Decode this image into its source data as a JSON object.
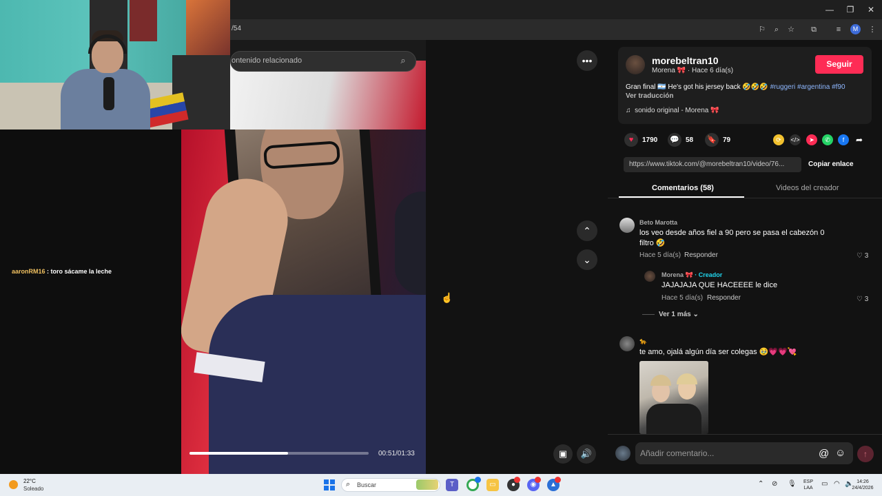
{
  "browser": {
    "url_fragment": "/54",
    "window_controls": [
      "—",
      "❐",
      "✕"
    ]
  },
  "stream": {
    "chat_user": "aaronRM16",
    "chat_message": " : toro sácame la leche"
  },
  "video": {
    "related_placeholder": "ontenido relacionado",
    "timecode": "00:51/01:33",
    "progress": 0.55
  },
  "post": {
    "username": "morebeltran10",
    "display_name": "Morena 🎀",
    "posted_ago": " · Hace 6 día(s)",
    "follow_label": "Seguir",
    "caption_text": "Gran final 🇦🇷 He's got his jersey back 🤣🤣🤣 ",
    "hashtags": "#ruggeri #argentina #f90",
    "translate_label": "Ver traducción",
    "sound_label": "sonido original - Morena 🎀",
    "likes": "1790",
    "comments": "58",
    "saves": "79",
    "link_url": "https://www.tiktok.com/@morebeltran10/video/76...",
    "copy_link_label": "Copiar enlace"
  },
  "tabs": {
    "comments": "Comentarios (58)",
    "creator_videos": "Videos del creador"
  },
  "comments": [
    {
      "user": "Beto Marotta",
      "text": "los veo desde años fiel a 90 pero se pasa el cabezón 0 filtro 🤣",
      "time": "Hace 5 día(s)",
      "reply_label": "Responder",
      "likes": "3"
    },
    {
      "user": "Morena 🎀",
      "creator_tag": " · Creador",
      "text": "JAJAJAJA QUE HACEEEE le dice",
      "time": "Hace 5 día(s)",
      "reply_label": "Responder",
      "likes": "3"
    },
    {
      "user": "🐆",
      "text": "te amo, ojalá algún día ser colegas 🥹💗💗💘"
    }
  ],
  "more_replies_label": "Ver 1 más ⌄",
  "add_comment_placeholder": "Añadir comentario...",
  "taskbar": {
    "temp": "22°C",
    "weather": "Soleado",
    "search_label": "Buscar",
    "lang_top": "ESP",
    "lang_bottom": "LAA",
    "time": "14:26",
    "date": "24/4/2026"
  }
}
